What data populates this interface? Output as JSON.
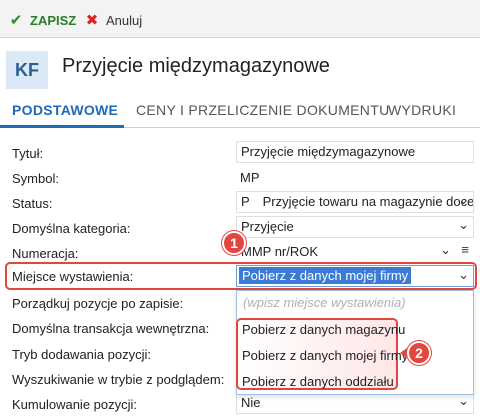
{
  "toolbar": {
    "save_label": "ZAPISZ",
    "cancel_label": "Anuluj",
    "save_icon": "check-icon",
    "cancel_icon": "close-icon"
  },
  "header": {
    "badge": "KF",
    "title": "Przyjęcie międzymagazynowe"
  },
  "tabs": [
    {
      "label": "PODSTAWOWE",
      "active": true
    },
    {
      "label": "CENY I PRZELICZENIE DOKUMENTU",
      "active": false
    },
    {
      "label": "WYDRUKI",
      "active": false
    }
  ],
  "form": {
    "tytul": {
      "label": "Tytuł:",
      "value": "Przyjęcie międzymagazynowe"
    },
    "symbol": {
      "label": "Symbol:",
      "value": "MP"
    },
    "status": {
      "label": "Status:",
      "code": "P",
      "value": "Przyjęcie towaru na magazynie docelo"
    },
    "kategoria": {
      "label": "Domyślna kategoria:",
      "value": "Przyjęcie"
    },
    "numeracja": {
      "label": "Numeracja:",
      "value": "MMP nr/ROK"
    },
    "miejsce": {
      "label": "Miejsce wystawienia:",
      "value": "Pobierz z danych mojej firmy"
    },
    "porzadkuj": {
      "label": "Porządkuj pozycje po zapisie:"
    },
    "transakcja": {
      "label": "Domyślna transakcja wewnętrzna:"
    },
    "tryb": {
      "label": "Tryb dodawania pozycji:"
    },
    "wyszukiwanie": {
      "label": "Wyszukiwanie w trybie z podglądem:"
    },
    "kumulowanie": {
      "label": "Kumulowanie pozycji:",
      "value": "Nie"
    }
  },
  "dropdown": {
    "placeholder": "(wpisz miejsce wystawienia)",
    "options": [
      "Pobierz z danych magazynu",
      "Pobierz z danych mojej firmy",
      "Pobierz z danych oddziału"
    ]
  },
  "callouts": [
    "1",
    "2"
  ],
  "colors": {
    "accent": "#1d6ab5",
    "highlight": "#e2463e",
    "save_green": "#2a7d2a"
  }
}
